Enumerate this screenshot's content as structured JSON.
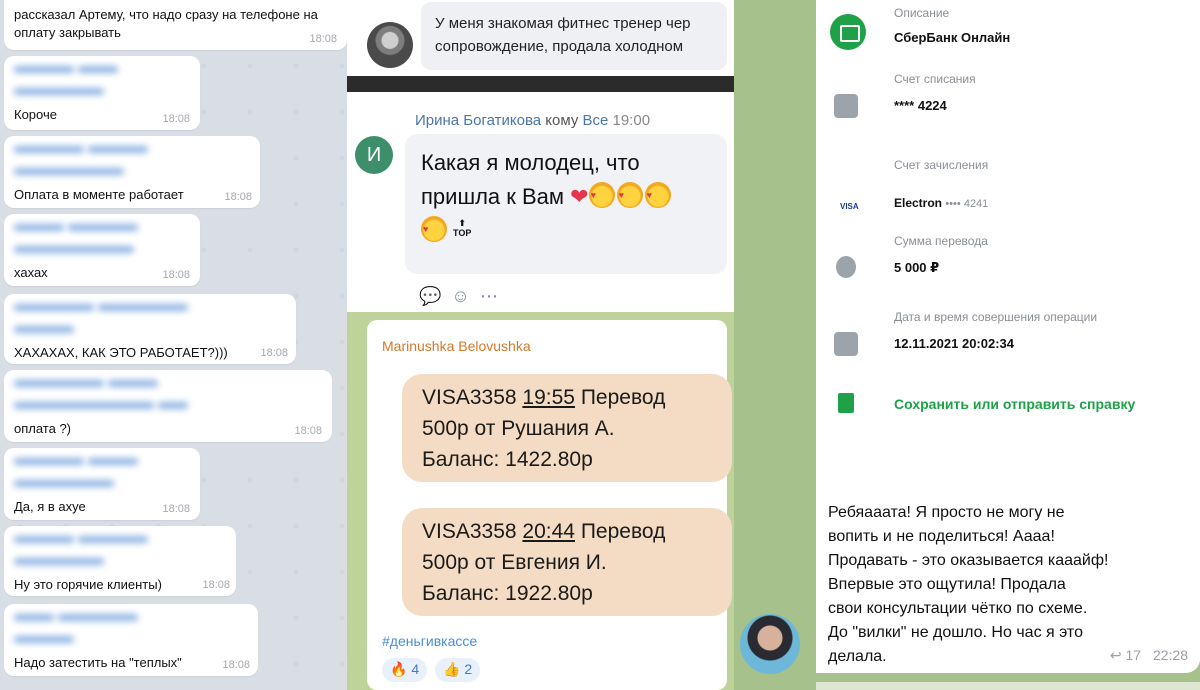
{
  "panel1": {
    "messages": [
      {
        "text": "рассказал Артему, что надо сразу на телефоне на оплату закрывать",
        "time": "18:08"
      },
      {
        "text": "Короче",
        "time": "18:08"
      },
      {
        "text": "Оплата в моменте работает",
        "time": "18:08"
      },
      {
        "text": "хахах",
        "time": "18:08"
      },
      {
        "text": "ХАХАХАХ, КАК ЭТО РАБОТАЕТ?)))",
        "time": "18:08"
      },
      {
        "text": "оплата ?)",
        "time": "18:08"
      },
      {
        "text": "Да, я в ахуе",
        "time": "18:08"
      },
      {
        "text": "Ну это горячие клиенты)",
        "time": "18:08"
      },
      {
        "text": "Надо затестить на \"теплых\"",
        "time": "18:08"
      }
    ]
  },
  "panel2": {
    "top_message": {
      "line1": "У меня знакомая фитнес тренер чер",
      "line2": "сопровождение, продала холодном"
    },
    "comment": {
      "avatar_letter": "И",
      "author": "Ирина Богатикова",
      "to_word": "кому",
      "to_target": "Все",
      "time": "19:00",
      "text_line1": "Какая я молодец, что",
      "text_line2": "пришла к Вам",
      "top_label": "TOP"
    },
    "forward": {
      "author": "Marinushka Belovushka",
      "sms": [
        {
          "card": "VISA3358",
          "time": "19:55",
          "line2": "500р от Рушания А.",
          "line3": "Баланс: 1422.80р",
          "action": "Перевод"
        },
        {
          "card": "VISA3358",
          "time": "20:44",
          "line2": "500р от Евгения И.",
          "line3": "Баланс: 1922.80р",
          "action": "Перевод"
        }
      ],
      "hashtag": "#деньгивкассе",
      "reactions": [
        {
          "icon": "fire-icon",
          "glyph": "🔥",
          "count": "4"
        },
        {
          "icon": "thumbs-up-icon",
          "glyph": "👍",
          "count": "2"
        }
      ]
    }
  },
  "panel3": {
    "receipt": {
      "description_label": "Описание",
      "description_value": "СберБанк Онлайн",
      "debit_label": "Счет списания",
      "debit_value": "**** 4224",
      "credit_label": "Счет зачисления",
      "credit_card_type": "VISA",
      "credit_value": "Electron",
      "credit_mask": "•••• 4241",
      "amount_label": "Сумма перевода",
      "amount_value": "5 000 ₽",
      "datetime_label": "Дата и время совершения операции",
      "datetime_value": "12.11.2021 20:02:34",
      "save_link": "Сохранить или отправить справку"
    },
    "message": {
      "lines": [
        "Ребяааата! Я просто не могу не",
        "вопить и не поделиться! Аааа!",
        "Продавать - это оказывается кааайф!",
        "Впервые это ощутила! Продала",
        "свои консультации чётко по схеме.",
        "До \"вилки\" не дошло. Но час я это",
        "делала."
      ],
      "replies": "17",
      "time": "22:28"
    }
  },
  "colors": {
    "telegram_bg": "#d9dde4",
    "sber_green": "#1fa14a",
    "sms_bubble": "#f4dcc4",
    "vk_link": "#4a76a8",
    "forward_author": "#d7772a"
  }
}
